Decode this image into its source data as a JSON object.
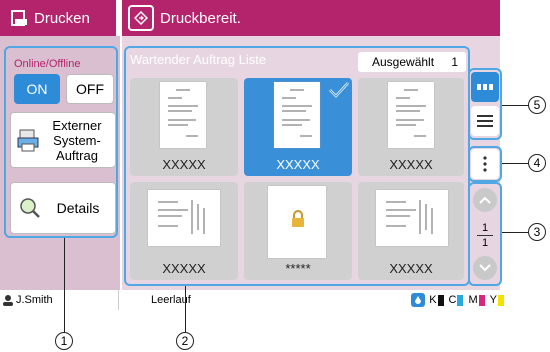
{
  "header": {
    "app_title": "Drucken",
    "status_text": "Druckbereit."
  },
  "sidebar": {
    "online_offline_label": "Online/Offline",
    "on_label": "ON",
    "off_label": "OFF",
    "external_job_label_1": "Externer",
    "external_job_label_2": "System-",
    "external_job_label_3": "Auftrag",
    "details_label": "Details"
  },
  "main": {
    "list_title": "Wartender Auftrag Liste",
    "selected_label": "Ausgewählt",
    "selected_count": "1",
    "jobs": [
      {
        "label": "XXXXX",
        "selected": false
      },
      {
        "label": "XXXXX",
        "selected": true
      },
      {
        "label": "XXXXX",
        "selected": false
      },
      {
        "label": "XXXXX",
        "selected": false
      },
      {
        "label": "*****",
        "selected": false,
        "locked": true
      },
      {
        "label": "XXXXX",
        "selected": false
      }
    ],
    "page_current": "1",
    "page_total": "1"
  },
  "footer": {
    "user": "J.Smith",
    "state": "Leerlauf",
    "ink_labels": [
      "K",
      "C",
      "M",
      "Y"
    ]
  },
  "callouts": [
    "1",
    "2",
    "3",
    "4",
    "5"
  ],
  "colors": {
    "header": "#b3246d",
    "accent_blue": "#2e8bd8",
    "ink_k": "#111111",
    "ink_c": "#2aa9e0",
    "ink_m": "#d6267f",
    "ink_y": "#f2e200"
  }
}
